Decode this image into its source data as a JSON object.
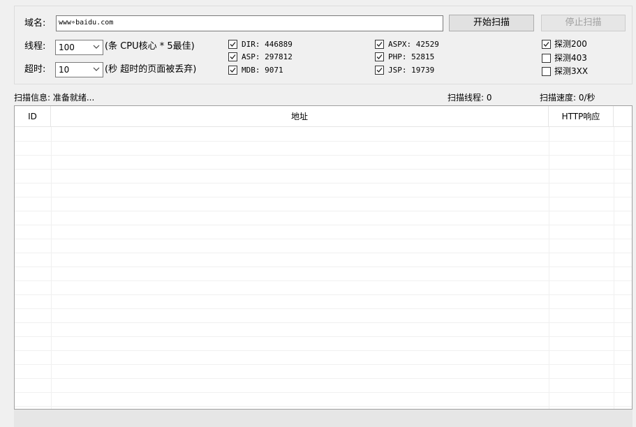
{
  "form": {
    "domain_label": "域名:",
    "domain_value": "www∘baidu.com",
    "start_button": "开始扫描",
    "stop_button": "停止扫描",
    "threads_label": "线程:",
    "threads_value": "100",
    "threads_hint": "(条 CPU核心 * 5最佳)",
    "timeout_label": "超时:",
    "timeout_value": "10",
    "timeout_hint": "(秒 超时的页面被丢弃)"
  },
  "dictionaries": [
    {
      "label": "DIR: 446889",
      "checked": true
    },
    {
      "label": "ASP: 297812",
      "checked": true
    },
    {
      "label": "MDB: 9071",
      "checked": true
    },
    {
      "label": "ASPX: 42529",
      "checked": true
    },
    {
      "label": "PHP: 52815",
      "checked": true
    },
    {
      "label": "JSP: 19739",
      "checked": true
    }
  ],
  "probes": [
    {
      "label": "探测200",
      "checked": true
    },
    {
      "label": "探测403",
      "checked": false
    },
    {
      "label": "探测3XX",
      "checked": false
    }
  ],
  "status": {
    "info": "扫描信息: 准备就绪...",
    "threads": "扫描线程: 0",
    "speed": "扫描速度: 0/秒"
  },
  "table": {
    "columns": [
      "ID",
      "地址",
      "HTTP响应"
    ]
  },
  "icons": {
    "checkmark": "check-icon",
    "dropdown": "chevron-down-icon"
  }
}
